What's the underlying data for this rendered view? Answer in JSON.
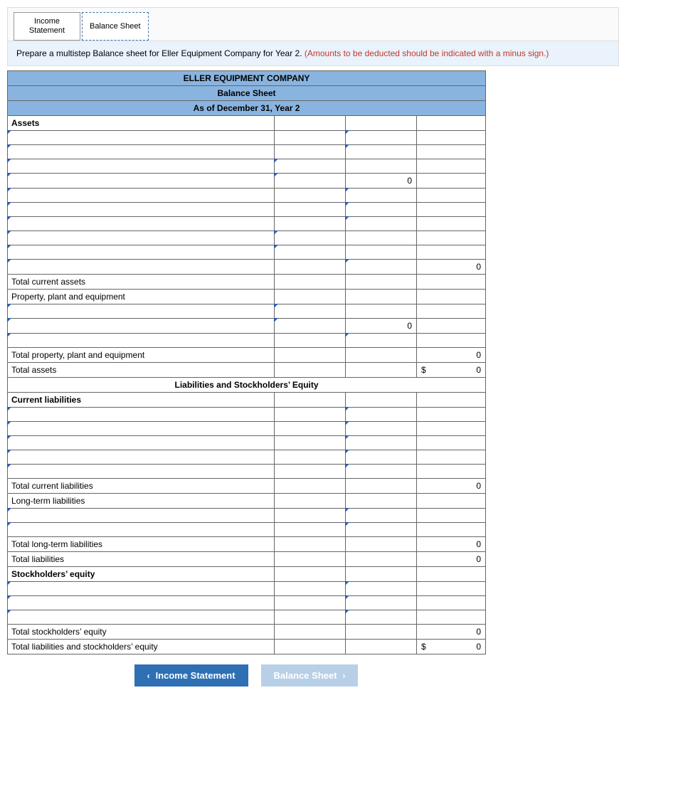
{
  "tabs": {
    "income": "Income Statement",
    "balance": "Balance Sheet"
  },
  "instruction": {
    "main": "Prepare a multistep Balance sheet for Eller Equipment Company for Year 2. ",
    "warn": "(Amounts to be deducted should be indicated with a minus sign.)"
  },
  "header": {
    "company": "ELLER EQUIPMENT COMPANY",
    "title": "Balance Sheet",
    "asof": "As of December 31, Year 2"
  },
  "sections": {
    "assets": "Assets",
    "tca": "Total current assets",
    "ppe": "Property, plant and equipment",
    "tppe": "Total property, plant and equipment",
    "ta": "Total assets",
    "lse": "Liabilities and Stockholders’ Equity",
    "cl": "Current liabilities",
    "tcl": "Total current liabilities",
    "ltl": "Long-term liabilities",
    "tltl": "Total long-term liabilities",
    "tl": "Total liabilities",
    "se": "Stockholders’ equity",
    "tse": "Total stockholders’ equity",
    "tlse": "Total liabilities and stockholders’ equity"
  },
  "vals": {
    "zero": "0",
    "dollar": "$"
  },
  "nav": {
    "prev": "Income Statement",
    "next": "Balance Sheet"
  }
}
